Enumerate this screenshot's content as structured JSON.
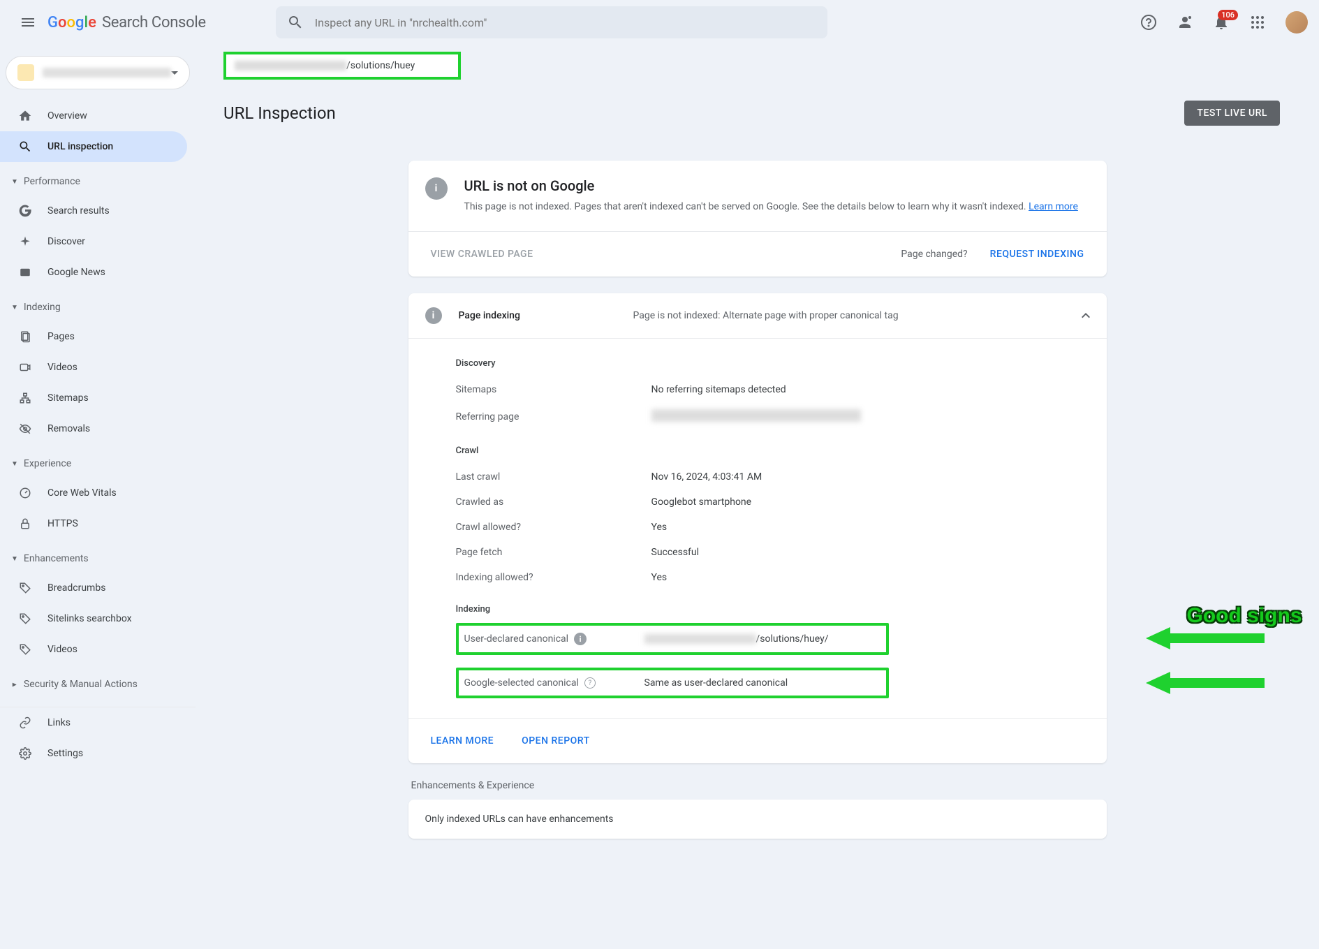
{
  "header": {
    "search_placeholder": "Inspect any URL in \"nrchealth.com\"",
    "notification_count": "106"
  },
  "sidebar": {
    "overview": "Overview",
    "url_inspection": "URL inspection",
    "sections": {
      "performance": "Performance",
      "indexing": "Indexing",
      "experience": "Experience",
      "enhancements": "Enhancements",
      "security": "Security & Manual Actions"
    },
    "items": {
      "search_results": "Search results",
      "discover": "Discover",
      "google_news": "Google News",
      "pages": "Pages",
      "videos": "Videos",
      "sitemaps": "Sitemaps",
      "removals": "Removals",
      "core_web_vitals": "Core Web Vitals",
      "https": "HTTPS",
      "breadcrumbs": "Breadcrumbs",
      "sitelinks_searchbox": "Sitelinks searchbox",
      "videos2": "Videos",
      "links": "Links",
      "settings": "Settings"
    }
  },
  "main": {
    "inspected_url_suffix": "/solutions/huey",
    "page_title": "URL Inspection",
    "test_live_btn": "TEST LIVE URL",
    "status": {
      "title": "URL is not on Google",
      "desc": "This page is not indexed. Pages that aren't indexed can't be served on Google. See the details below to learn why it wasn't indexed. ",
      "learn_more": "Learn more"
    },
    "footer": {
      "view_crawled": "VIEW CRAWLED PAGE",
      "page_changed": "Page changed?",
      "request_indexing": "REQUEST INDEXING"
    },
    "indexing_section": {
      "title": "Page indexing",
      "status": "Page is not indexed: Alternate page with proper canonical tag"
    },
    "details": {
      "discovery_title": "Discovery",
      "sitemaps_label": "Sitemaps",
      "sitemaps_value": "No referring sitemaps detected",
      "referring_page_label": "Referring page",
      "crawl_title": "Crawl",
      "last_crawl_label": "Last crawl",
      "last_crawl_value": "Nov 16, 2024, 4:03:41 AM",
      "crawled_as_label": "Crawled as",
      "crawled_as_value": "Googlebot smartphone",
      "crawl_allowed_label": "Crawl allowed?",
      "crawl_allowed_value": "Yes",
      "page_fetch_label": "Page fetch",
      "page_fetch_value": "Successful",
      "indexing_allowed_label": "Indexing allowed?",
      "indexing_allowed_value": "Yes",
      "indexing_title": "Indexing",
      "user_canonical_label": "User-declared canonical",
      "user_canonical_suffix": "/solutions/huey/",
      "google_canonical_label": "Google-selected canonical",
      "google_canonical_value": "Same as user-declared canonical"
    },
    "annotation": "Good signs",
    "actions": {
      "learn_more": "LEARN MORE",
      "open_report": "OPEN REPORT"
    },
    "enhancements": {
      "title": "Enhancements & Experience",
      "message": "Only indexed URLs can have enhancements"
    }
  }
}
